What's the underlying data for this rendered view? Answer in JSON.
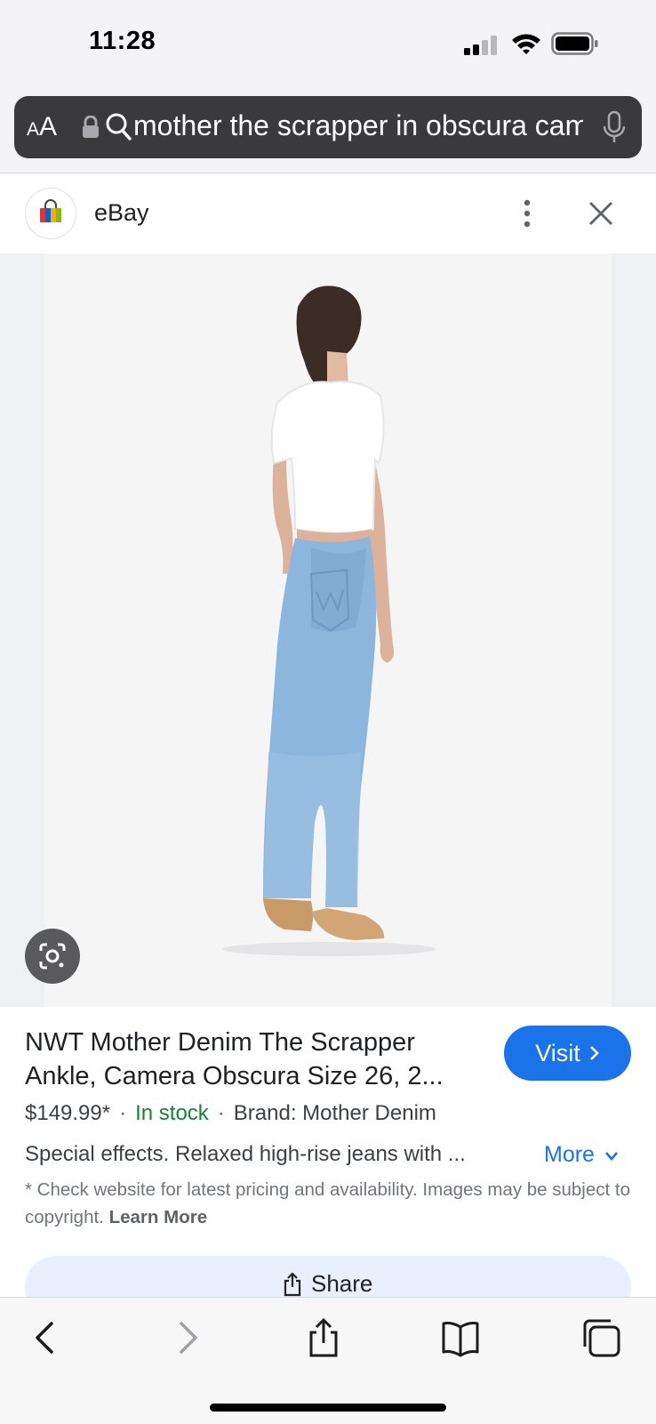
{
  "status_bar": {
    "time": "11:28"
  },
  "url_bar": {
    "aa_label_small": "A",
    "aa_label_large": "A",
    "query": "mother the scrapper in obscura camera"
  },
  "site": {
    "name": "eBay"
  },
  "product": {
    "title": "NWT Mother Denim The Scrapper Ankle, Camera Obscura Size 26, 2...",
    "price": "$149.99*",
    "stock": "In stock",
    "brand": "Brand: Mother Denim",
    "description": "Special effects. Relaxed high-rise jeans with ...",
    "more_label": "More",
    "disclaimer": "* Check website for latest pricing and availability. Images may be subject to copyright.",
    "learn_more": "Learn More"
  },
  "actions": {
    "visit_label": "Visit",
    "share_label": "Share"
  },
  "colors": {
    "accent": "#1a73e8",
    "in_stock": "#188038",
    "url_bar_bg": "#3a3a3c"
  },
  "icons": [
    "signal-icon",
    "wifi-icon",
    "battery-icon",
    "lock-icon",
    "search-icon",
    "mic-icon",
    "ebay-bag-icon",
    "more-vert-icon",
    "close-icon",
    "lens-icon",
    "chevron-right-icon",
    "chevron-down-icon",
    "share-icon",
    "back-icon",
    "forward-icon",
    "bookmarks-icon",
    "tabs-icon"
  ]
}
